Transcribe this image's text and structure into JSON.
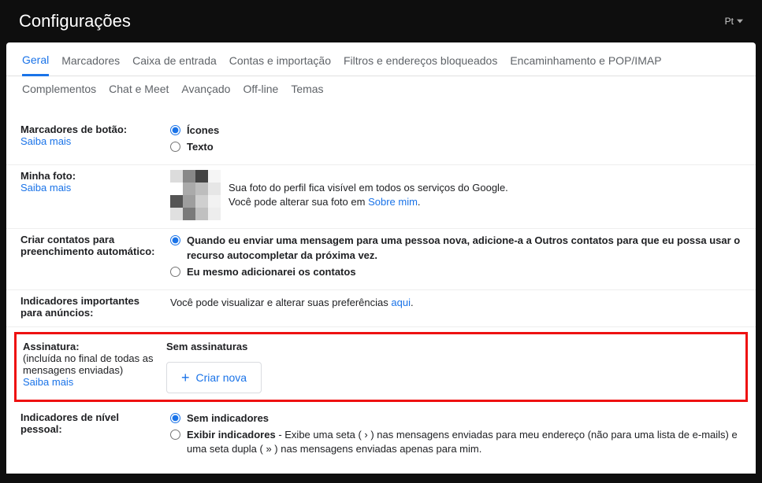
{
  "header": {
    "title": "Configurações",
    "lang": "Pt"
  },
  "tabs": {
    "row1": [
      "Geral",
      "Marcadores",
      "Caixa de entrada",
      "Contas e importação",
      "Filtros e endereços bloqueados",
      "Encaminhamento e POP/IMAP"
    ],
    "row2": [
      "Complementos",
      "Chat e Meet",
      "Avançado",
      "Off-line",
      "Temas"
    ]
  },
  "buttonLabels": {
    "title": "Marcadores de botão:",
    "learnMore": "Saiba mais",
    "opt1": "Ícones",
    "opt2": "Texto"
  },
  "photo": {
    "title": "Minha foto:",
    "learnMore": "Saiba mais",
    "line1": "Sua foto do perfil fica visível em todos os serviços do Google.",
    "line2a": "Você pode alterar sua foto em ",
    "aboutLink": "Sobre mim",
    "period": "."
  },
  "autoContacts": {
    "title1": "Criar contatos para",
    "title2": "preenchimento automático:",
    "opt1": "Quando eu enviar uma mensagem para uma pessoa nova, adicione-a a Outros contatos para que eu possa usar o recurso autocompletar da próxima vez.",
    "opt2": "Eu mesmo adicionarei os contatos"
  },
  "ads": {
    "title1": "Indicadores importantes",
    "title2": "para anúncios:",
    "textA": "Você pode visualizar e alterar suas preferências ",
    "link": "aqui",
    "textB": "."
  },
  "signature": {
    "title": "Assinatura:",
    "sub": "(incluída no final de todas as mensagens enviadas)",
    "learnMore": "Saiba mais",
    "heading": "Sem assinaturas",
    "createBtn": "Criar nova"
  },
  "personal": {
    "title1": "Indicadores de nível",
    "title2": "pessoal:",
    "opt1": "Sem indicadores",
    "opt2bold": "Exibir indicadores",
    "opt2rest": " - Exibe uma seta ( › ) nas mensagens enviadas para meu endereço (não para uma lista de e-mails) e uma seta dupla ( » ) nas mensagens enviadas apenas para mim."
  }
}
